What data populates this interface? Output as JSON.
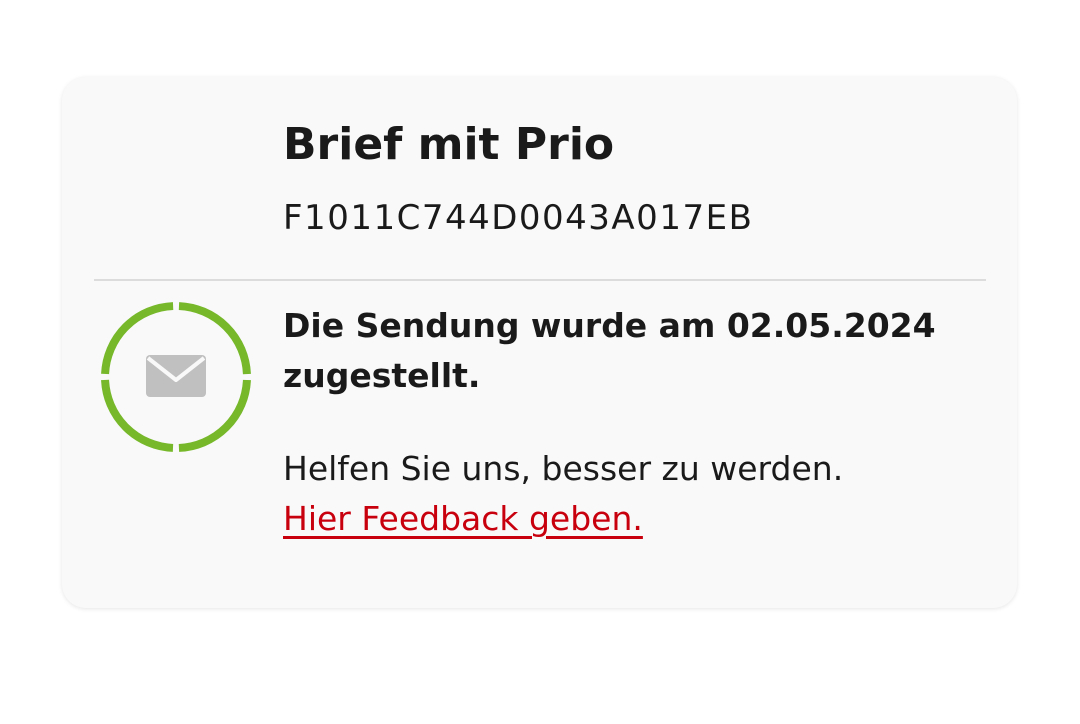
{
  "shipment": {
    "title": "Brief mit Prio",
    "tracking_number": "F1011C744D0043A017EB"
  },
  "status": {
    "icon": "envelope-icon",
    "ring_color": "#76b82a",
    "icon_color": "#c0c0c0",
    "message": "Die Sendung wurde am 02.05.2024 zugestellt."
  },
  "feedback": {
    "prompt": "Helfen Sie uns, besser zu werden.",
    "link_label": "Hier Feedback geben.",
    "link_color": "#c8000e"
  }
}
